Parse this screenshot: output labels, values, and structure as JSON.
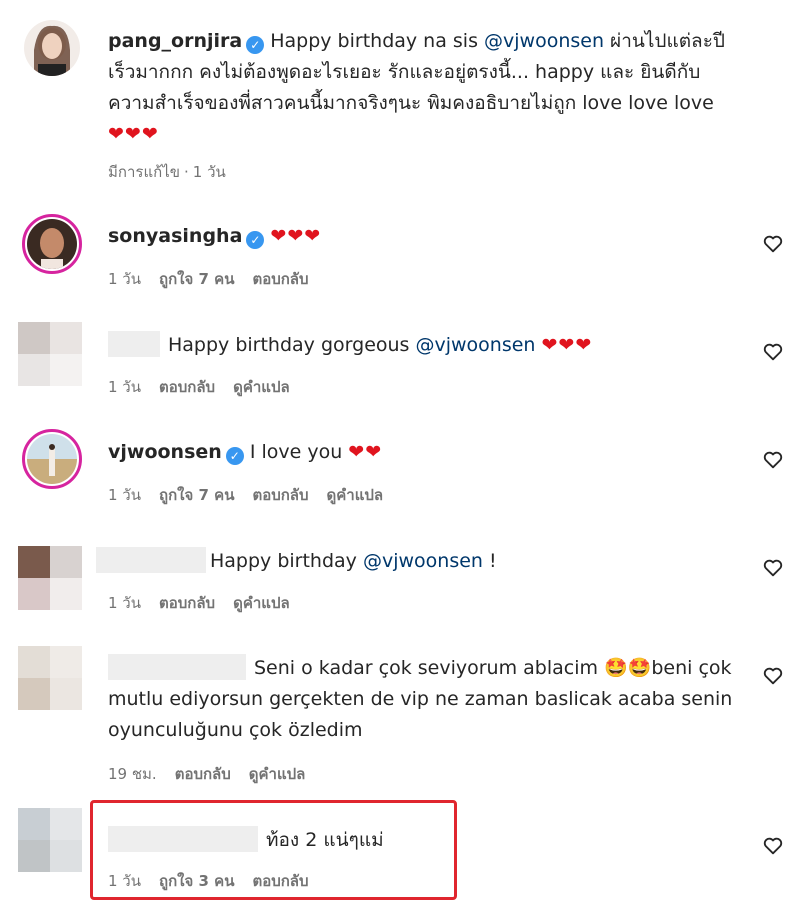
{
  "comments": [
    {
      "username": "pang_ornjira",
      "verified": true,
      "text_before": "Happy birthday na sis ",
      "mention": "@vjwoonsen",
      "text_after": " ผ่านไปแต่ละปีเร็วมากกก คงไม่ต้องพูดอะไรเยอะ รักและอยู่ตรงนี้... happy และ ยินดีกับความสำเร็จของพี่สาวคนนี้มากจริงๆนะ พิมคงอธิบายไม่ถูก love love love",
      "hearts": "❤❤❤",
      "edited": "มีการแก้ไข",
      "time": "1 วัน"
    },
    {
      "username": "sonyasingha",
      "verified": true,
      "hearts": "❤❤❤",
      "time": "1 วัน",
      "likes": "ถูกใจ 7 คน",
      "reply": "ตอบกลับ"
    },
    {
      "text": "Happy birthday gorgeous ",
      "mention": "@vjwoonsen",
      "hearts": "❤❤❤",
      "time": "1 วัน",
      "reply": "ตอบกลับ",
      "translate": "ดูคำแปล"
    },
    {
      "username": "vjwoonsen",
      "verified": true,
      "text": "I love you",
      "hearts": "❤❤",
      "time": "1 วัน",
      "likes": "ถูกใจ 7 คน",
      "reply": "ตอบกลับ",
      "translate": "ดูคำแปล"
    },
    {
      "text": "Happy birthday ",
      "mention": "@vjwoonsen",
      "text_after": " !",
      "time": "1 วัน",
      "reply": "ตอบกลับ",
      "translate": "ดูคำแปล"
    },
    {
      "text": "Seni o kadar çok seviyorum ablacim 🤩🤩beni çok mutlu ediyorsun gerçekten de vip ne zaman baslicak acaba senin oyunculuğunu çok özledim",
      "time": "19 ชม.",
      "reply": "ตอบกลับ",
      "translate": "ดูคำแปล"
    },
    {
      "text": "ท้อง 2 แน่ๆแม่",
      "time": "1 วัน",
      "likes": "ถูกใจ 3 คน",
      "reply": "ตอบกลับ"
    }
  ],
  "colors": {
    "verified": "#3897f0",
    "mention": "#00376b",
    "heart": "#e0141e",
    "highlight": "#e0262e"
  },
  "icons": {
    "like": "heart-outline-icon",
    "verified": "verified-badge-icon"
  }
}
